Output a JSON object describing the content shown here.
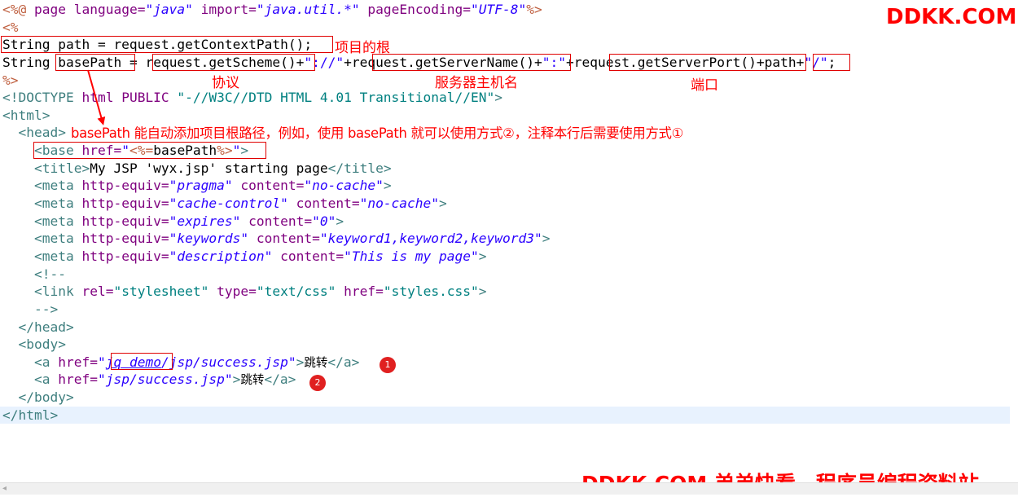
{
  "code": {
    "l1": {
      "open": "<%@",
      "kw1": " page language=",
      "v1": "\"java\"",
      "kw2": " import=",
      "v2": "\"java.util.*\"",
      "kw3": " pageEncoding=",
      "v3": "\"UTF-8\"",
      "close": "%>"
    },
    "l2": "<%",
    "l3": "String path = request.getContextPath();",
    "l4": {
      "a": "String ",
      "b": "basePath",
      "c": " = ",
      "d": "request.getScheme()",
      "e": "+",
      "f": "\"://\"",
      "g": "+",
      "h": "request.getServerName()",
      "i": "+",
      "j": "\":\"",
      "k": "+",
      "l": "request.getServerPort()",
      "m": "+",
      "n": "path",
      "o": "+",
      "p": "\"/\"",
      "q": ";"
    },
    "l5": "%>",
    "l6": {
      "a": "<!DOCTYPE ",
      "b": "html",
      "c": " PUBLIC ",
      "d": "\"-//W3C//DTD HTML 4.01 Transitional//EN\"",
      "e": ">"
    },
    "l7": "<html>",
    "l8": "<head>",
    "l9": {
      "a": "<base ",
      "b": "href=",
      "c": "\"",
      "d": "<%=",
      "e": "basePath",
      "f": "%>",
      "g": "\"",
      "h": ">"
    },
    "l10": {
      "a": "<title>",
      "b": "My JSP 'wyx.jsp' starting page",
      "c": "</title>"
    },
    "l11": {
      "a": "<meta ",
      "b": "http-equiv=",
      "c": "\"pragma\"",
      "d": " content=",
      "e": "\"no-cache\"",
      "f": ">"
    },
    "l12": {
      "a": "<meta ",
      "b": "http-equiv=",
      "c": "\"cache-control\"",
      "d": " content=",
      "e": "\"no-cache\"",
      "f": ">"
    },
    "l13": {
      "a": "<meta ",
      "b": "http-equiv=",
      "c": "\"expires\"",
      "d": " content=",
      "e": "\"0\"",
      "f": ">"
    },
    "l14": {
      "a": "<meta ",
      "b": "http-equiv=",
      "c": "\"keywords\"",
      "d": " content=",
      "e": "\"keyword1,keyword2,keyword3\"",
      "f": ">"
    },
    "l15": {
      "a": "<meta ",
      "b": "http-equiv=",
      "c": "\"description\"",
      "d": " content=",
      "e": "\"This is my page\"",
      "f": ">"
    },
    "l16": "<!--",
    "l17": {
      "a": "<link ",
      "b": "rel=",
      "c": "\"stylesheet\"",
      "d": " type=",
      "e": "\"text/css\"",
      "f": " href=",
      "g": "\"styles.css\"",
      "h": ">"
    },
    "l18": "-->",
    "l19": "</head>",
    "l20": "<body>",
    "l21": {
      "a": "<a ",
      "b": "href=",
      "c": "\"",
      "d": "jq_demo",
      "e": "/jsp/success.jsp\"",
      "f": ">",
      "g": "跳转",
      "h": "</a>"
    },
    "l22": {
      "a": "<a ",
      "b": "href=",
      "c": "\"jsp/success.jsp\"",
      "d": ">",
      "e": "跳转",
      "f": "</a>"
    },
    "l23": "</body>",
    "l24": "</html>"
  },
  "annotations": {
    "context_root": "项目的根",
    "protocol": "协议",
    "server_host": "服务器主机名",
    "port": "端口",
    "note": "basePath 能自动添加项目根路径，例如，使用 basePath 就可以使用方式②，注释本行后需要使用方式①",
    "marker1": "1",
    "marker2": "2"
  },
  "watermarks": {
    "top": "DDKK.COM",
    "bottom": "DDKK.COM 弟弟快看，程序员编程资料站"
  },
  "colors": {
    "annotation_red": "#ff0000",
    "highlight_line": "#e8f2fe",
    "tag": "#3f7f7f",
    "attr": "#7f007f",
    "string": "#2a00ff",
    "directive": "#bf5f3f"
  }
}
